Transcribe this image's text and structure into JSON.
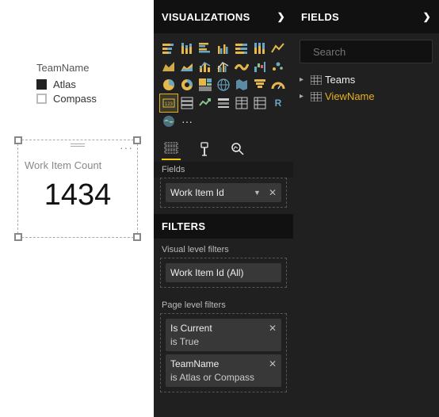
{
  "canvas": {
    "legend_title": "TeamName",
    "legend_items": [
      "Atlas",
      "Compass"
    ],
    "card": {
      "title": "Work Item Count",
      "value": "1434"
    }
  },
  "viz_pane": {
    "title": "VISUALIZATIONS",
    "fields_section_label": "Fields",
    "field_chip": "Work Item Id",
    "filters_header": "FILTERS",
    "visual_filters_label": "Visual level filters",
    "visual_filter_chip": "Work Item Id  (All)",
    "page_filters_label": "Page level filters",
    "page_filters": [
      {
        "name": "Is Current",
        "desc": "is True"
      },
      {
        "name": "TeamName",
        "desc": "is Atlas or Compass"
      }
    ]
  },
  "fields_pane": {
    "title": "FIELDS",
    "search_placeholder": "Search",
    "tables": [
      {
        "name": "Teams",
        "highlight": false
      },
      {
        "name": "ViewName",
        "highlight": true
      }
    ]
  },
  "chart_data": {
    "type": "table",
    "title": "Work Item Count",
    "values": [
      1434
    ]
  }
}
